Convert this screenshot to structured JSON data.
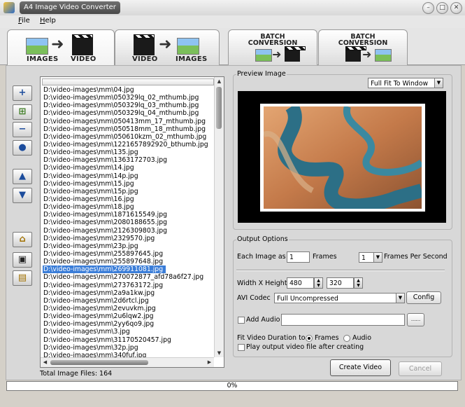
{
  "window": {
    "title": "A4 Image Video Converter"
  },
  "menu": [
    {
      "label": "File",
      "underline": "F",
      "rest": "ile"
    },
    {
      "label": "Help",
      "underline": "H",
      "rest": "elp"
    }
  ],
  "tabs": [
    {
      "from": "IMAGES",
      "to": "VIDEO"
    },
    {
      "from": "VIDEO",
      "to": "IMAGES"
    },
    {
      "line1": "BATCH",
      "line2": "CONVERSION"
    },
    {
      "line1": "BATCH",
      "line2": "CONVERSION"
    }
  ],
  "files": [
    "D:\\video-images\\mm\\04.jpg",
    "D:\\video-images\\mm\\050329lq_02_mthumb.jpg",
    "D:\\video-images\\mm\\050329lq_03_mthumb.jpg",
    "D:\\video-images\\mm\\050329lq_04_mthumb.jpg",
    "D:\\video-images\\mm\\050413mm_17_mthumb.jpg",
    "D:\\video-images\\mm\\050518mm_18_mthumb.jpg",
    "D:\\video-images\\mm\\050610kzm_02_mthumb.jpg",
    "D:\\video-images\\mm\\1221657892920_bthumb.jpg",
    "D:\\video-images\\mm\\135.jpg",
    "D:\\video-images\\mm\\1363172703.jpg",
    "D:\\video-images\\mm\\14.jpg",
    "D:\\video-images\\mm\\14p.jpg",
    "D:\\video-images\\mm\\15.jpg",
    "D:\\video-images\\mm\\15p.jpg",
    "D:\\video-images\\mm\\16.jpg",
    "D:\\video-images\\mm\\18.jpg",
    "D:\\video-images\\mm\\1871615549.jpg",
    "D:\\video-images\\mm\\2080188655.jpg",
    "D:\\video-images\\mm\\2126309803.jpg",
    "D:\\video-images\\mm\\2329570.jpg",
    "D:\\video-images\\mm\\23p.jpg",
    "D:\\video-images\\mm\\255897645.jpg",
    "D:\\video-images\\mm\\255897648.jpg",
    "D:\\video-images\\mm\\269911081.jpg",
    "D:\\video-images\\mm\\270072877_afd78a6f27.jpg",
    "D:\\video-images\\mm\\273763172.jpg",
    "D:\\video-images\\mm\\2a9a1kw.jpg",
    "D:\\video-images\\mm\\2d6rtcl.jpg",
    "D:\\video-images\\mm\\2evuvkm.jpg",
    "D:\\video-images\\mm\\2u6lqw2.jpg",
    "D:\\video-images\\mm\\2yy6qo9.jpg",
    "D:\\video-images\\mm\\3.jpg",
    "D:\\video-images\\mm\\31170520457.jpg",
    "D:\\video-images\\mm\\32p.jpg",
    "D:\\video-images\\mm\\340fuf.jpg"
  ],
  "selected_index": 23,
  "total_label": "Total Image Files: 164",
  "preview": {
    "title": "Preview Image",
    "fit_mode": "Full Fit To Window"
  },
  "output": {
    "title": "Output Options",
    "each_image_label": "Each Image as",
    "frames_value": "1",
    "frames_label": "Frames",
    "fps_value": "1",
    "fps_label": "Frames Per Second",
    "wh_label": "Width X Height",
    "width": "480",
    "height": "320",
    "codec_label": "AVI Codec",
    "codec_value": "Full Uncompressed",
    "config_label": "Config",
    "add_audio_label": "Add Audio",
    "audio_browse": "......",
    "fit_label": "Fit Video Duration to",
    "fit_frames": "Frames",
    "fit_audio": "Audio",
    "play_label": "Play output video file after creating"
  },
  "actions": {
    "create": "Create Video",
    "cancel": "Cancel"
  },
  "progress": {
    "value": 0,
    "text": "0%"
  },
  "colors": {
    "selection": "#3a7dd8",
    "preview_bg": "#000000"
  }
}
